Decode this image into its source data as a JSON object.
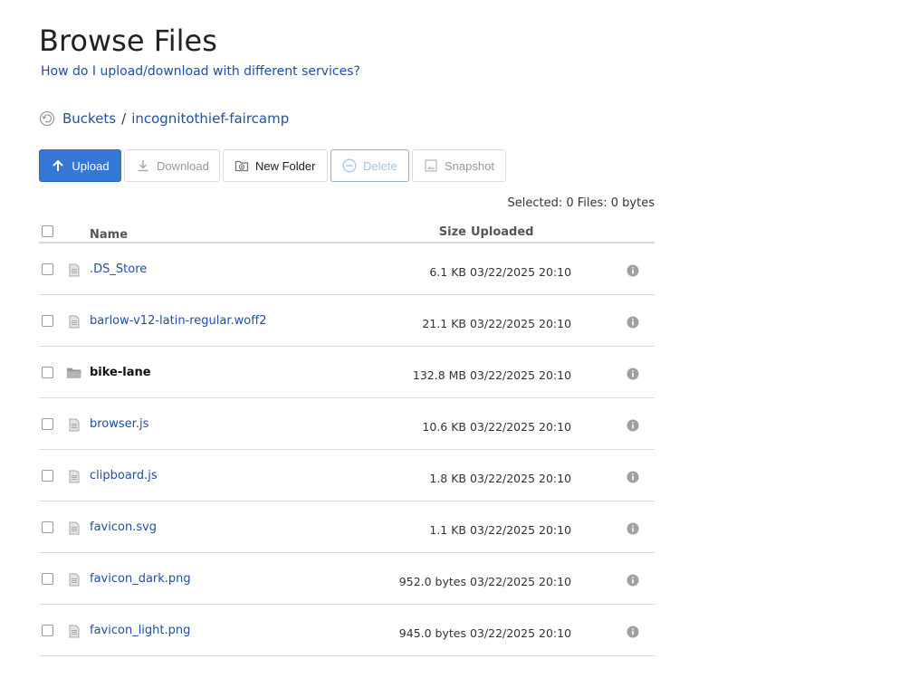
{
  "page": {
    "title": "Browse Files",
    "help_link": "How do I upload/download with different services?"
  },
  "breadcrumb": {
    "root": "Buckets",
    "separator": "/",
    "bucket": "incognitothief-faircamp"
  },
  "toolbar": {
    "upload": "Upload",
    "download": "Download",
    "new_folder": "New Folder",
    "delete": "Delete",
    "snapshot": "Snapshot"
  },
  "selection": {
    "summary": "Selected: 0 Files: 0 bytes"
  },
  "table": {
    "columns": {
      "name": "Name",
      "size": "Size",
      "uploaded": "Uploaded"
    },
    "rows": [
      {
        "name": ".DS_Store",
        "type": "file",
        "size": "6.1 KB",
        "uploaded": "03/22/2025 20:10"
      },
      {
        "name": "barlow-v12-latin-regular.woff2",
        "type": "file",
        "size": "21.1 KB",
        "uploaded": "03/22/2025 20:10"
      },
      {
        "name": "bike-lane",
        "type": "folder",
        "size": "132.8 MB",
        "uploaded": "03/22/2025 20:10"
      },
      {
        "name": "browser.js",
        "type": "file",
        "size": "10.6 KB",
        "uploaded": "03/22/2025 20:10"
      },
      {
        "name": "clipboard.js",
        "type": "file",
        "size": "1.8 KB",
        "uploaded": "03/22/2025 20:10"
      },
      {
        "name": "favicon.svg",
        "type": "file",
        "size": "1.1 KB",
        "uploaded": "03/22/2025 20:10"
      },
      {
        "name": "favicon_dark.png",
        "type": "file",
        "size": "952.0 bytes",
        "uploaded": "03/22/2025 20:10"
      },
      {
        "name": "favicon_light.png",
        "type": "file",
        "size": "945.0 bytes",
        "uploaded": "03/22/2025 20:10"
      }
    ]
  },
  "colors": {
    "link": "#1f4fa8",
    "primary_button": "#3478d4"
  }
}
